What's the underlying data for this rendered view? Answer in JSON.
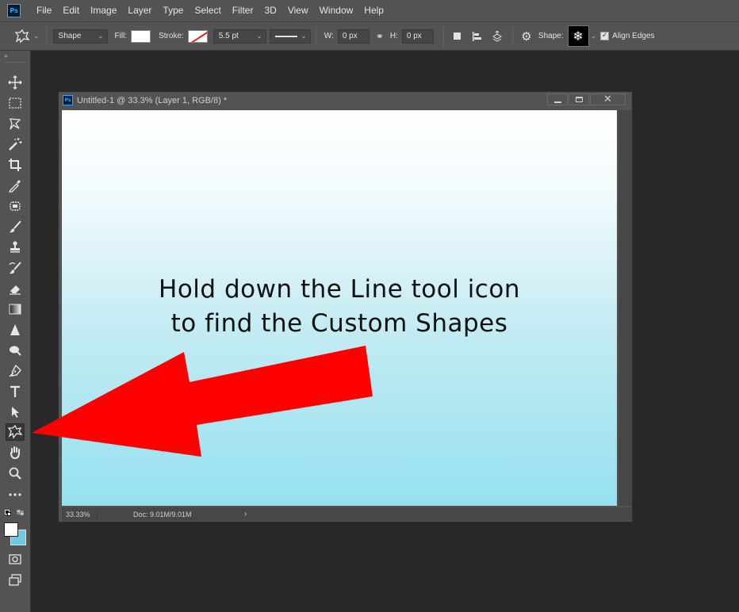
{
  "app": {
    "logo": "Ps",
    "menu": [
      "File",
      "Edit",
      "Image",
      "Layer",
      "Type",
      "Select",
      "Filter",
      "3D",
      "View",
      "Window",
      "Help"
    ]
  },
  "options_bar": {
    "mode": "Shape",
    "fill_label": "Fill:",
    "stroke_label": "Stroke:",
    "stroke_width": "5.5 pt",
    "w_label": "W:",
    "w_value": "0 px",
    "h_label": "H:",
    "h_value": "0 px",
    "shape_label": "Shape:",
    "align_edges_label": "Align Edges",
    "align_edges_checked": true,
    "fill_color": "#ffffff",
    "stroke_color": "#e02020"
  },
  "toolbar": {
    "tools": [
      {
        "name": "move-tool",
        "icon": "move-icon"
      },
      {
        "name": "rectangular-marquee-tool",
        "icon": "marquee-icon"
      },
      {
        "name": "lasso-tool",
        "icon": "lasso-icon"
      },
      {
        "name": "magic-wand-tool",
        "icon": "magic-wand-icon"
      },
      {
        "name": "crop-tool",
        "icon": "crop-icon"
      },
      {
        "name": "eyedropper-tool",
        "icon": "eyedropper-icon"
      },
      {
        "name": "patch-tool",
        "icon": "patch-icon"
      },
      {
        "name": "brush-tool",
        "icon": "brush-icon"
      },
      {
        "name": "clone-stamp-tool",
        "icon": "stamp-icon"
      },
      {
        "name": "history-brush-tool",
        "icon": "history-brush-icon"
      },
      {
        "name": "eraser-tool",
        "icon": "eraser-icon"
      },
      {
        "name": "gradient-tool",
        "icon": "gradient-icon"
      },
      {
        "name": "sharpen-tool",
        "icon": "sharpen-icon"
      },
      {
        "name": "dodge-tool",
        "icon": "dodge-icon"
      },
      {
        "name": "pen-tool",
        "icon": "pen-icon"
      },
      {
        "name": "type-tool",
        "icon": "type-icon"
      },
      {
        "name": "path-selection-tool",
        "icon": "path-selection-icon"
      },
      {
        "name": "custom-shape-tool",
        "icon": "custom-shape-icon",
        "active": true
      },
      {
        "name": "hand-tool",
        "icon": "hand-icon"
      },
      {
        "name": "zoom-tool",
        "icon": "zoom-icon"
      },
      {
        "name": "edit-toolbar",
        "icon": "more-icon"
      }
    ],
    "foreground_color": "#ffffff",
    "background_color": "#6ccbe3"
  },
  "document": {
    "title": "Untitled-1 @ 33.3% (Layer 1, RGB/8) *",
    "zoom": "33.33%",
    "doc_size": "Doc: 9.01M/9.01M",
    "canvas_text_line1": "Hold down the Line tool icon",
    "canvas_text_line2": "to find the Custom Shapes",
    "arrow_color": "#ff0000"
  }
}
